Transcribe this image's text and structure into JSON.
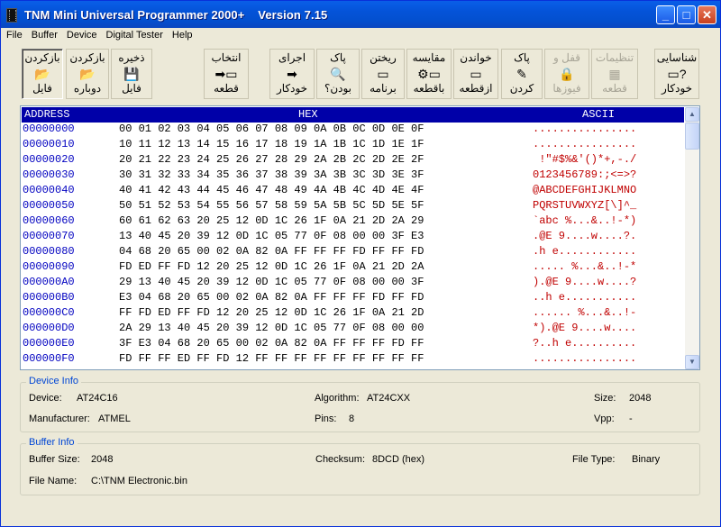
{
  "window": {
    "title": "TNM Mini Universal Programmer 2000+    Version 7.15",
    "minimize_glyph": "_",
    "maximize_glyph": "□",
    "close_glyph": "✕"
  },
  "menu": [
    "File",
    "Buffer",
    "Device",
    "Digital Tester",
    "Help"
  ],
  "toolbar": [
    {
      "line1": "بازکردن",
      "icon": "folder-open",
      "glyph": "📂",
      "line2": "فایل",
      "enabled": true,
      "pressed": true
    },
    {
      "line1": "بازکردن",
      "icon": "folder-open",
      "glyph": "📂",
      "line2": "دوباره",
      "enabled": true,
      "pressed": false
    },
    {
      "line1": "ذخیره",
      "icon": "floppy-disk",
      "glyph": "💾",
      "line2": "فایل",
      "enabled": true,
      "pressed": false
    },
    {
      "line1": "انتخاب",
      "icon": "chip-select",
      "glyph": "➡▭",
      "line2": "قطعه",
      "enabled": true,
      "pressed": false
    },
    {
      "line1": "اجرای",
      "icon": "arrow-right",
      "glyph": "➡",
      "line2": "خودکار",
      "enabled": true,
      "pressed": false
    },
    {
      "line1": "پاک",
      "icon": "blank-check",
      "glyph": "🔍",
      "line2": "بودن؟",
      "enabled": true,
      "pressed": false
    },
    {
      "line1": "ریختن",
      "icon": "program-chip",
      "glyph": "▭",
      "line2": "برنامه",
      "enabled": true,
      "pressed": false
    },
    {
      "line1": "مقایسه",
      "icon": "verify",
      "glyph": "⚙▭",
      "line2": "باقطعه",
      "enabled": true,
      "pressed": false
    },
    {
      "line1": "خواندن",
      "icon": "read-chip",
      "glyph": "▭",
      "line2": "ازقطعه",
      "enabled": true,
      "pressed": false
    },
    {
      "line1": "پاک",
      "icon": "erase",
      "glyph": "✎",
      "line2": "کردن",
      "enabled": true,
      "pressed": false
    },
    {
      "line1": "قفل و",
      "icon": "lock",
      "glyph": "🔒",
      "line2": "فیوزها",
      "enabled": false,
      "pressed": false
    },
    {
      "line1": "تنظیمات",
      "icon": "chip-settings",
      "glyph": "▦",
      "line2": "قطعه",
      "enabled": false,
      "pressed": false
    },
    {
      "line1": "شناسایی",
      "icon": "chip-detect",
      "glyph": "▭?",
      "line2": "خودکار",
      "enabled": true,
      "pressed": false
    }
  ],
  "hex": {
    "header_address": "ADDRESS",
    "header_hex": "HEX",
    "header_ascii": "ASCII",
    "rows": [
      {
        "addr": "00000000",
        "bytes": "00 01 02 03 04 05 06 07 08 09 0A 0B 0C 0D 0E 0F",
        "ascii": "................"
      },
      {
        "addr": "00000010",
        "bytes": "10 11 12 13 14 15 16 17 18 19 1A 1B 1C 1D 1E 1F",
        "ascii": "................"
      },
      {
        "addr": "00000020",
        "bytes": "20 21 22 23 24 25 26 27 28 29 2A 2B 2C 2D 2E 2F",
        "ascii": " !\"#$%&'()*+,-./"
      },
      {
        "addr": "00000030",
        "bytes": "30 31 32 33 34 35 36 37 38 39 3A 3B 3C 3D 3E 3F",
        "ascii": "0123456789:;<=>?"
      },
      {
        "addr": "00000040",
        "bytes": "40 41 42 43 44 45 46 47 48 49 4A 4B 4C 4D 4E 4F",
        "ascii": "@ABCDEFGHIJKLMNO"
      },
      {
        "addr": "00000050",
        "bytes": "50 51 52 53 54 55 56 57 58 59 5A 5B 5C 5D 5E 5F",
        "ascii": "PQRSTUVWXYZ[\\]^_"
      },
      {
        "addr": "00000060",
        "bytes": "60 61 62 63 20 25 12 0D 1C 26 1F 0A 21 2D 2A 29",
        "ascii": "`abc %...&..!-*)"
      },
      {
        "addr": "00000070",
        "bytes": "13 40 45 20 39 12 0D 1C 05 77 0F 08 00 00 3F E3",
        "ascii": ".@E 9....w....?."
      },
      {
        "addr": "00000080",
        "bytes": "04 68 20 65 00 02 0A 82 0A FF FF FF FD FF FF FD",
        "ascii": ".h e............"
      },
      {
        "addr": "00000090",
        "bytes": "FD ED FF FD 12 20 25 12 0D 1C 26 1F 0A 21 2D 2A",
        "ascii": "..... %...&..!-*"
      },
      {
        "addr": "000000A0",
        "bytes": "29 13 40 45 20 39 12 0D 1C 05 77 0F 08 00 00 3F",
        "ascii": ").@E 9....w....?"
      },
      {
        "addr": "000000B0",
        "bytes": "E3 04 68 20 65 00 02 0A 82 0A FF FF FF FD FF FD",
        "ascii": "..h e..........."
      },
      {
        "addr": "000000C0",
        "bytes": "FF FD ED FF FD 12 20 25 12 0D 1C 26 1F 0A 21 2D",
        "ascii": "...... %...&..!-"
      },
      {
        "addr": "000000D0",
        "bytes": "2A 29 13 40 45 20 39 12 0D 1C 05 77 0F 08 00 00",
        "ascii": "*).@E 9....w...."
      },
      {
        "addr": "000000E0",
        "bytes": "3F E3 04 68 20 65 00 02 0A 82 0A FF FF FF FD FF",
        "ascii": "?..h e.........."
      },
      {
        "addr": "000000F0",
        "bytes": "FD FF FF ED FF FD 12 FF FF FF FF FF FF FF FF FF",
        "ascii": "................"
      }
    ]
  },
  "device_info": {
    "title": "Device Info",
    "device_label": "Device:",
    "device_value": "AT24C16",
    "algorithm_label": "Algorithm:",
    "algorithm_value": "AT24CXX",
    "size_label": "Size:",
    "size_value": "2048",
    "manufacturer_label": "Manufacturer:",
    "manufacturer_value": "ATMEL",
    "pins_label": "Pins:",
    "pins_value": "8",
    "vpp_label": "Vpp:",
    "vpp_value": "-"
  },
  "buffer_info": {
    "title": "Buffer Info",
    "size_label": "Buffer Size:",
    "size_value": "2048",
    "checksum_label": "Checksum:",
    "checksum_value": "8DCD (hex)",
    "filetype_label": "File Type:",
    "filetype_value": "Binary",
    "filename_label": "File Name:",
    "filename_value": "C:\\TNM Electronic.bin"
  },
  "colors": {
    "hex_header_bg": "#0000a8",
    "address_text": "#0000c0",
    "ascii_text": "#c00000",
    "group_title": "#0046d5"
  }
}
